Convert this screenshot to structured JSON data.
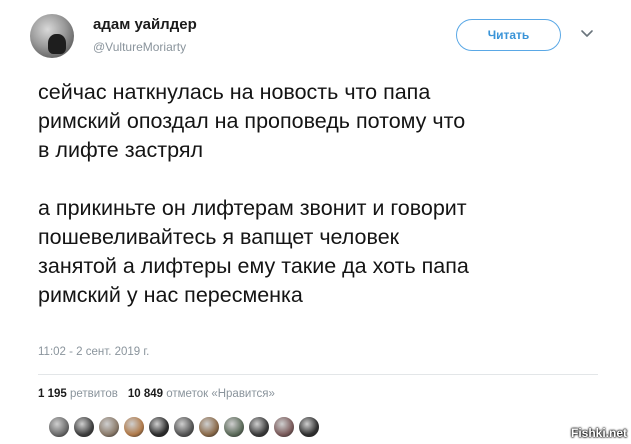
{
  "tweet": {
    "author": {
      "display_name": "адам уайлдер",
      "handle": "@VultureMoriarty"
    },
    "follow_label": "Читать",
    "paragraphs": [
      "сейчас наткнулась на новость что папа\nримский опоздал на проповедь потому что\nв лифте застрял",
      "а прикиньте он лифтерам звонит и говорит\nпошевеливайтесь я вапщет человек\nзанятой а лифтеры ему такие да хоть папа\nримский у нас пересменка"
    ],
    "timestamp": "11:02 - 2 сент. 2019 г.",
    "stats": {
      "retweets_count": "1 195",
      "retweets_label": "ретвитов",
      "likes_count": "10 849",
      "likes_label": "отметок «Нравится»"
    },
    "liker_avatars": [
      {
        "color": "#6b6b6b"
      },
      {
        "color": "#3f3f3f"
      },
      {
        "color": "#8a7a6a"
      },
      {
        "color": "#b07a4a"
      },
      {
        "color": "#2c2c2c"
      },
      {
        "color": "#555555"
      },
      {
        "color": "#8a6a4a"
      },
      {
        "color": "#5c6b5a"
      },
      {
        "color": "#3a3a3a"
      },
      {
        "color": "#7a5a5a"
      },
      {
        "color": "#2f2f2f"
      }
    ],
    "accent_color": "#3a94d8"
  },
  "watermark": "Fishki.net"
}
